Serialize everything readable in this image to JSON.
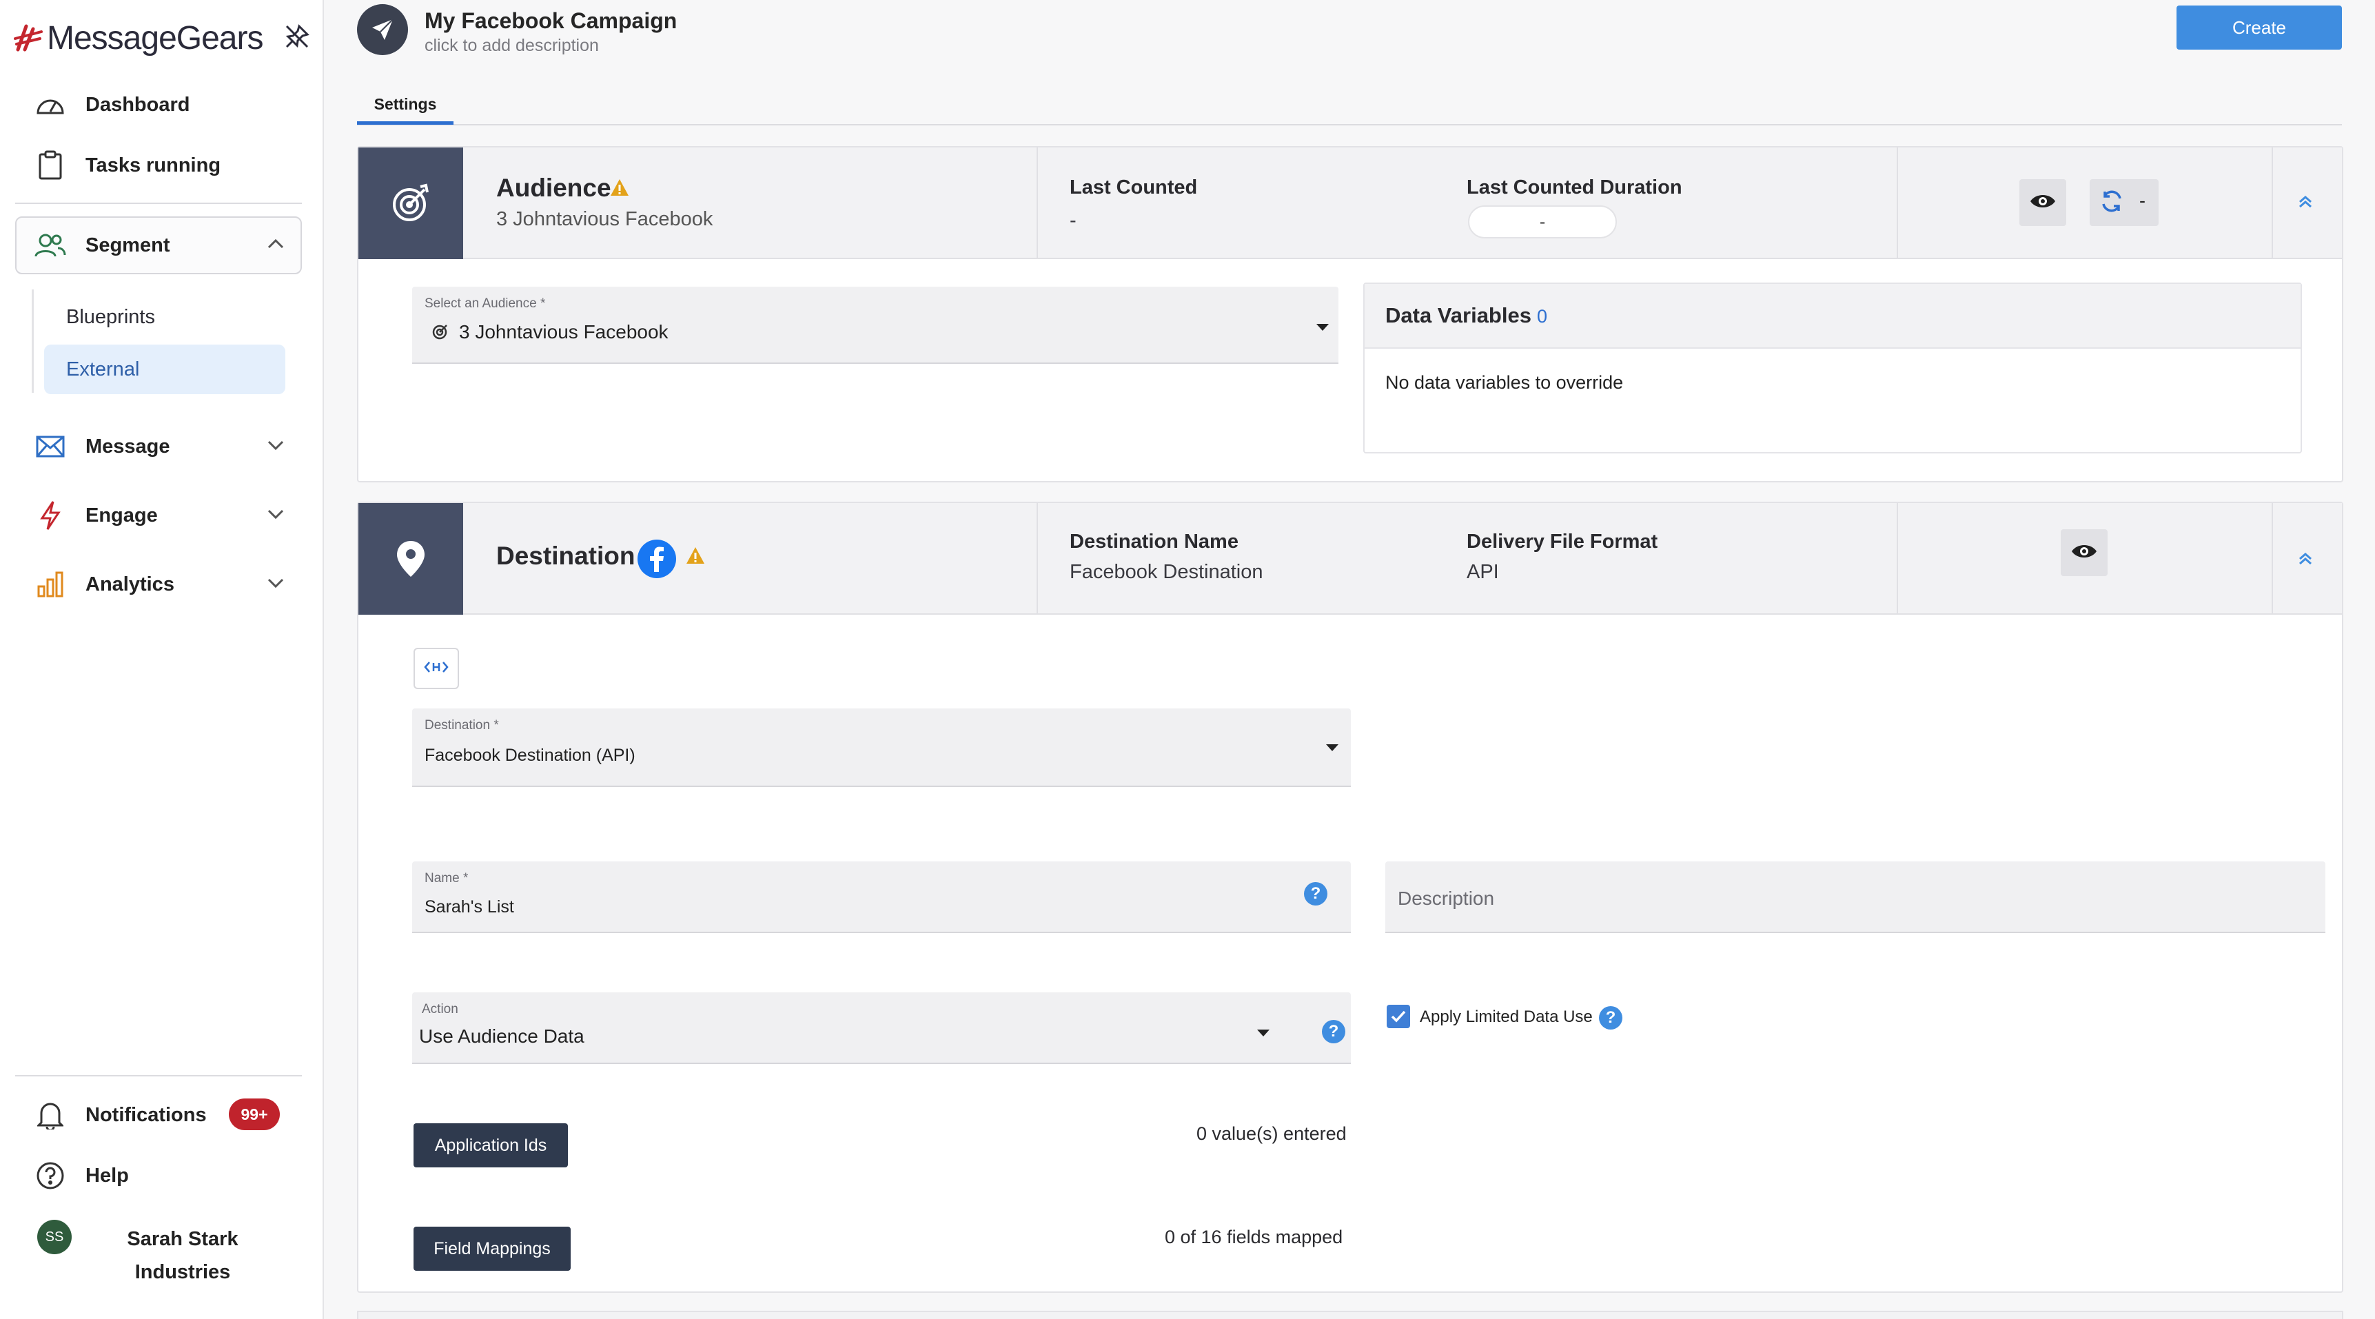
{
  "brand": {
    "name": "MessageGears",
    "accent": "#3f8de0",
    "sidebar_header_color": "#464f67"
  },
  "sidebar": {
    "items": [
      {
        "label": "Dashboard",
        "icon": "dashboard-gauge-icon"
      },
      {
        "label": "Tasks running",
        "icon": "clipboard-icon"
      },
      {
        "label": "Segment",
        "icon": "users-icon",
        "expanded": true,
        "children": [
          {
            "label": "Blueprints",
            "active": false
          },
          {
            "label": "External",
            "active": true
          }
        ]
      },
      {
        "label": "Message",
        "icon": "envelope-icon"
      },
      {
        "label": "Engage",
        "icon": "lightning-icon"
      },
      {
        "label": "Analytics",
        "icon": "bar-chart-icon"
      }
    ],
    "footer": {
      "notifications": {
        "label": "Notifications",
        "badge": "99+"
      },
      "help": {
        "label": "Help"
      },
      "user": {
        "initials": "SS",
        "org_line1": "Sarah Stark",
        "org_line2": "Industries"
      }
    }
  },
  "header": {
    "title": "My Facebook Campaign",
    "description_placeholder": "click to add description",
    "create_label": "Create"
  },
  "tabs": [
    {
      "label": "Settings",
      "active": true
    }
  ],
  "audience": {
    "title": "Audience",
    "subtitle": "3 Johntavious Facebook",
    "last_counted_label": "Last Counted",
    "last_counted_value": "-",
    "last_counted_duration_label": "Last Counted Duration",
    "last_counted_duration_value": "-",
    "refresh_value": "-",
    "select_label": "Select an Audience *",
    "select_value": "3 Johntavious Facebook",
    "data_variables": {
      "title": "Data Variables",
      "count": "0",
      "empty_text": "No data variables to override"
    }
  },
  "destination": {
    "title": "Destination",
    "name_label": "Destination Name",
    "name_value": "Facebook Destination",
    "format_label": "Delivery File Format",
    "format_value": "API",
    "select_label": "Destination *",
    "select_value": "Facebook Destination (API)",
    "list_name_label": "Name *",
    "list_name_value": "Sarah's List",
    "description_placeholder": "Description",
    "action_label": "Action",
    "action_value": "Use Audience Data",
    "limited_data_label": "Apply Limited Data Use",
    "limited_data_checked": true,
    "app_ids_label": "Application Ids",
    "app_ids_count": "0 value(s) entered",
    "field_mappings_label": "Field Mappings",
    "field_mappings_count": "0 of 16 fields mapped"
  }
}
